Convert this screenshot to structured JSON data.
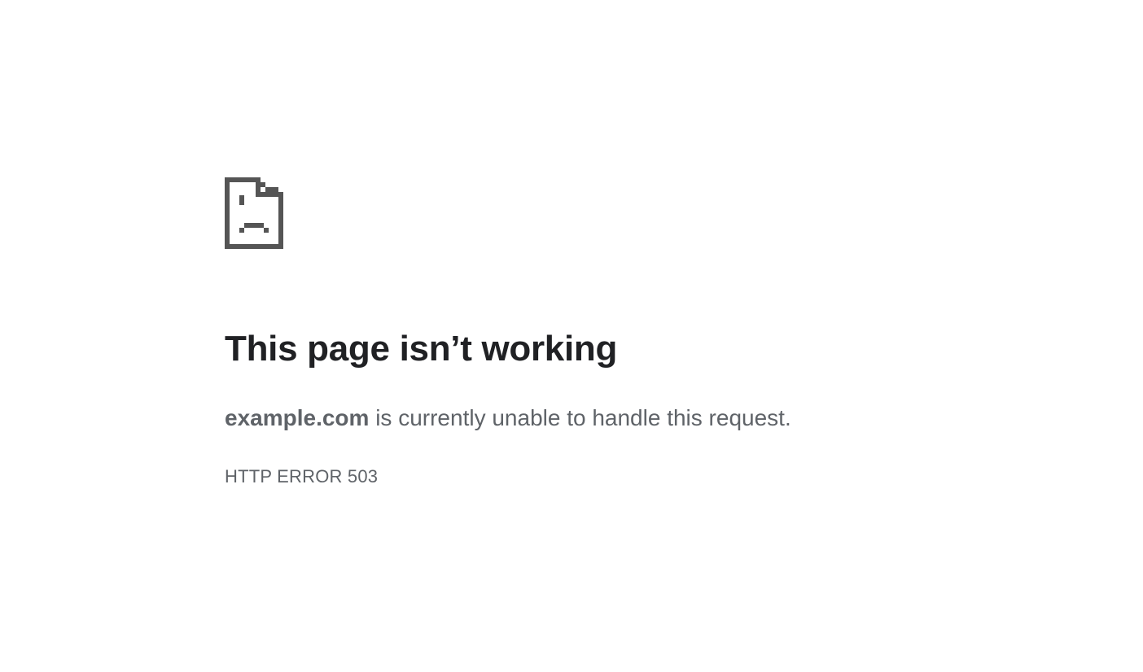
{
  "icon": {
    "name": "sad-page-icon",
    "color": "#555555"
  },
  "heading": "This page isn’t working",
  "message": {
    "host": "example.com",
    "text": " is currently unable to handle this request."
  },
  "error_code": "HTTP ERROR 503",
  "colors": {
    "heading": "#202124",
    "body_text": "#5f6368",
    "background": "#ffffff"
  }
}
